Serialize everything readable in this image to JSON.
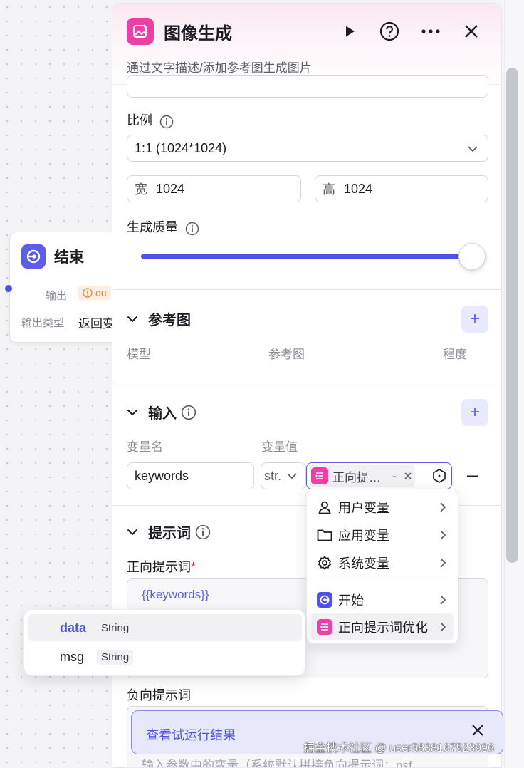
{
  "end_node": {
    "title": "结束",
    "output_label": "输出",
    "output_tag": "ou",
    "output_type_label": "输出类型",
    "output_type_value": "返回变"
  },
  "panel": {
    "title": "图像生成",
    "description": "通过文字描述/添加参考图生成图片"
  },
  "ratio": {
    "label": "比例",
    "value": "1:1 (1024*1024)"
  },
  "size": {
    "width_label": "宽",
    "width_value": "1024",
    "height_label": "高",
    "height_value": "1024"
  },
  "quality": {
    "label": "生成质量",
    "value_fraction": 1.0
  },
  "reference": {
    "title": "参考图",
    "col_model": "模型",
    "col_image": "参考图",
    "col_degree": "程度"
  },
  "input": {
    "title": "输入",
    "col_name": "变量名",
    "col_value": "变量值",
    "var_name": "keywords",
    "var_type": "str.",
    "var_ref": "正向提…",
    "var_ref_suffix": "-"
  },
  "prompt": {
    "title": "提示词",
    "positive_label": "正向提示词",
    "required_mark": "*",
    "positive_value": "{{keywords}}",
    "negative_label": "负向提示词",
    "negative_placeholder": "输入参数中的变量（系统默认拼接负向提示词：nsf"
  },
  "dropdown": {
    "items": [
      {
        "label": "用户变量",
        "icon": "user-icon"
      },
      {
        "label": "应用变量",
        "icon": "folder-icon"
      },
      {
        "label": "系统变量",
        "icon": "gear-icon"
      },
      {
        "label": "开始",
        "icon": "start-node-icon"
      },
      {
        "label": "正向提示词优化",
        "icon": "prompt-node-icon"
      }
    ]
  },
  "sub_popup": {
    "items": [
      {
        "name": "data",
        "type": "String"
      },
      {
        "name": "msg",
        "type": "String"
      }
    ]
  },
  "toast": {
    "text": "查看试运行结果"
  },
  "watermark": "掘金技术社区 @ user5838167523996",
  "colors": {
    "accent": "#4d53e8",
    "pink": "#ef3fa7",
    "purple_node": "#5b5cf0"
  }
}
